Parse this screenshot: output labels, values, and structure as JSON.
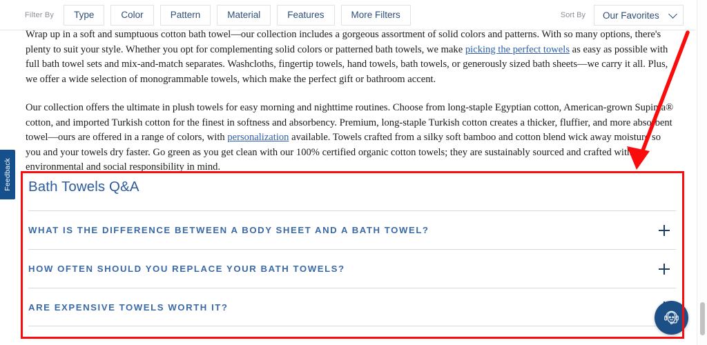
{
  "filter_bar": {
    "filter_label": "Filter By",
    "buttons": [
      {
        "label": "Type"
      },
      {
        "label": "Color"
      },
      {
        "label": "Pattern"
      },
      {
        "label": "Material"
      },
      {
        "label": "Features"
      },
      {
        "label": "More Filters"
      }
    ],
    "sort_label": "Sort By",
    "sort_value": "Our Favorites",
    "sort_caret_icon": "chevron-down-icon"
  },
  "copy": {
    "p1_a": "Wrap up in a soft and sumptuous cotton bath towel—our collection includes a gorgeous assortment of solid colors and patterns. With so many options, there's plenty to suit your style. Whether you opt for complementing solid colors or patterned bath towels, we make ",
    "p1_link": "picking the perfect towels",
    "p1_b": " as easy as possible with full bath towel sets and mix-and-match separates. Washcloths, fingertip towels, hand towels, bath towels, or generously sized bath sheets—we carry it all. Plus, we offer a wide selection of monogrammable towels, which make the perfect gift or bathroom accent.",
    "p2_a": "Our collection offers the ultimate in plush towels for easy morning and nighttime routines. Choose from long-staple Egyptian cotton, American-grown Supima® cotton, and imported Turkish cotton for the finest in softness and absorbency. Premium, long-staple Turkish cotton creates a thicker, fluffier, and more absorbent towel—ours are offered in a range of colors, with ",
    "p2_link": "personalization",
    "p2_b": " available. Towels crafted from a silky soft bamboo and cotton blend wick away moisture so you and your towels dry faster. Go green as you get clean with our 100% certified organic cotton towels; they are sustainably sourced and crafted with environmental and social responsibility in mind."
  },
  "qa": {
    "title": "Bath Towels Q&A",
    "items": [
      {
        "question": "WHAT IS THE DIFFERENCE BETWEEN A BODY SHEET AND A BATH TOWEL?",
        "toggle_icon": "plus-icon"
      },
      {
        "question": "HOW OFTEN SHOULD YOU REPLACE YOUR BATH TOWELS?",
        "toggle_icon": "plus-icon"
      },
      {
        "question": "ARE EXPENSIVE TOWELS WORTH IT?",
        "toggle_icon": "plus-icon"
      }
    ]
  },
  "feedback_tab": {
    "label": "Feedback"
  },
  "chat": {
    "icon": "support-agent-headset-icon"
  },
  "annotation": {
    "arrow_color": "#fa0c0c",
    "box_color": "#fa0c0c"
  },
  "colors": {
    "brand_navy": "#1c4f86",
    "link_blue": "#2d5fa8",
    "qa_blue": "#3a69a8",
    "annotation_red": "#fa0c0c"
  }
}
